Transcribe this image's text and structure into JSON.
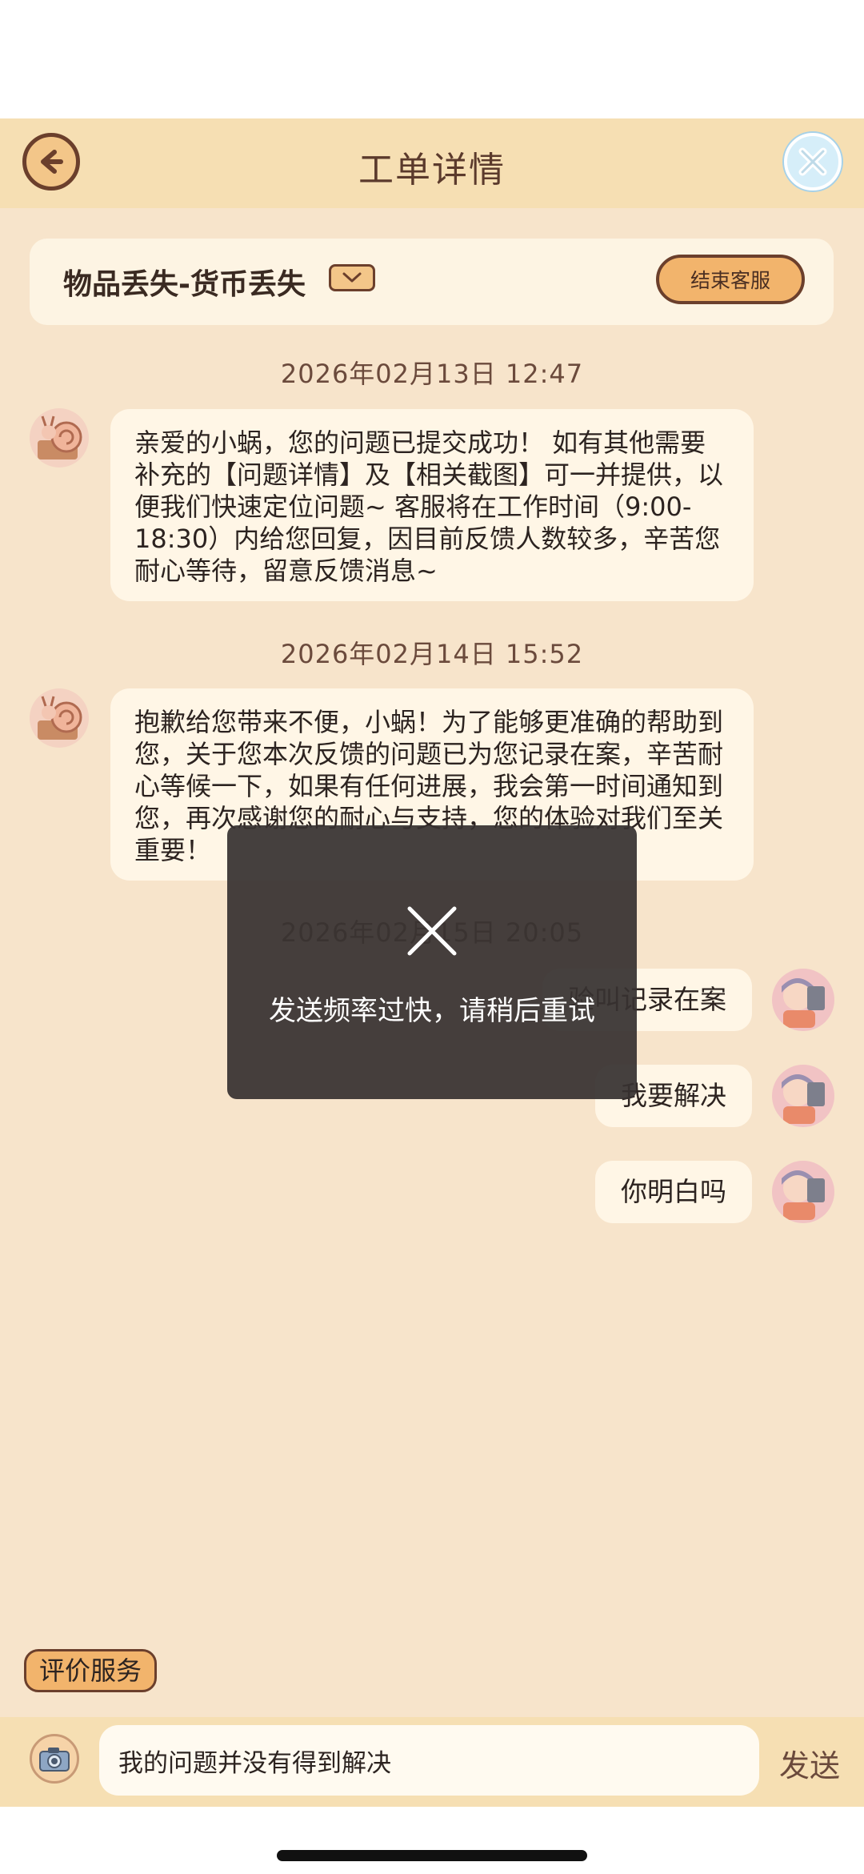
{
  "header": {
    "title": "工单详情",
    "back_icon": "arrow-left-icon",
    "close_icon": "close-icon"
  },
  "ticket": {
    "title": "物品丢失-货币丢失",
    "end_service_label": "结束客服"
  },
  "messages": [
    {
      "timestamp": "2026年02月13日 12:47",
      "sender": "agent",
      "text": "亲爱的小蜗，您的问题已提交成功！ 如有其他需要补充的【问题详情】及【相关截图】可一并提供，以便我们快速定位问题~ 客服将在工作时间（9:00-18:30）内给您回复，因目前反馈人数较多，辛苦您耐心等待，留意反馈消息~"
    },
    {
      "timestamp": "2026年02月14日 15:52",
      "sender": "agent",
      "text": "抱歉给您带来不便，小蜗！为了能够更准确的帮助到您，关于您本次反馈的问题已为您记录在案，辛苦耐心等候一下，如果有任何进展，我会第一时间通知到您，再次感谢您的耐心与支持，您的体验对我们至关重要！"
    },
    {
      "timestamp": "2026年02月15日 20:05",
      "sender": "user",
      "text": "验叫记录在案"
    },
    {
      "sender": "user",
      "text": "我要解决"
    },
    {
      "sender": "user",
      "text": "你明白吗"
    }
  ],
  "rate_button_label": "评价服务",
  "input": {
    "value": "我的问题并没有得到解决",
    "send_label": "发送"
  },
  "toast": {
    "text": "发送频率过快，请稍后重试"
  },
  "colors": {
    "header_bg": "#f6dfb3",
    "content_bg": "#f7e4cb",
    "bubble_bg": "#fff6e6",
    "accent": "#f2b46c",
    "border": "#6b3f2c"
  }
}
